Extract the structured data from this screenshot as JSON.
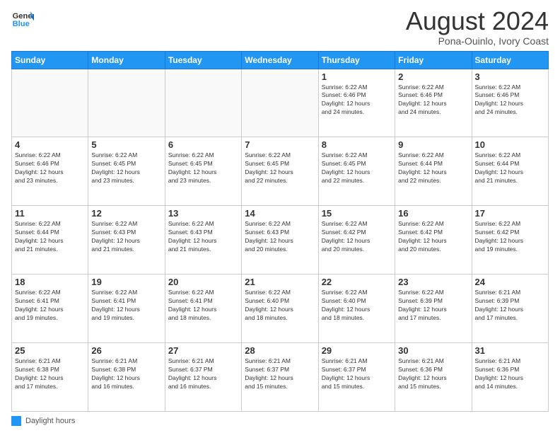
{
  "logo": {
    "line1": "General",
    "line2": "Blue"
  },
  "title": "August 2024",
  "subtitle": "Pona-Ouinlo, Ivory Coast",
  "days_of_week": [
    "Sunday",
    "Monday",
    "Tuesday",
    "Wednesday",
    "Thursday",
    "Friday",
    "Saturday"
  ],
  "legend": "Daylight hours",
  "weeks": [
    [
      {
        "day": "",
        "info": ""
      },
      {
        "day": "",
        "info": ""
      },
      {
        "day": "",
        "info": ""
      },
      {
        "day": "",
        "info": ""
      },
      {
        "day": "1",
        "info": "Sunrise: 6:22 AM\nSunset: 6:46 PM\nDaylight: 12 hours\nand 24 minutes."
      },
      {
        "day": "2",
        "info": "Sunrise: 6:22 AM\nSunset: 6:46 PM\nDaylight: 12 hours\nand 24 minutes."
      },
      {
        "day": "3",
        "info": "Sunrise: 6:22 AM\nSunset: 6:46 PM\nDaylight: 12 hours\nand 24 minutes."
      }
    ],
    [
      {
        "day": "4",
        "info": "Sunrise: 6:22 AM\nSunset: 6:46 PM\nDaylight: 12 hours\nand 23 minutes."
      },
      {
        "day": "5",
        "info": "Sunrise: 6:22 AM\nSunset: 6:45 PM\nDaylight: 12 hours\nand 23 minutes."
      },
      {
        "day": "6",
        "info": "Sunrise: 6:22 AM\nSunset: 6:45 PM\nDaylight: 12 hours\nand 23 minutes."
      },
      {
        "day": "7",
        "info": "Sunrise: 6:22 AM\nSunset: 6:45 PM\nDaylight: 12 hours\nand 22 minutes."
      },
      {
        "day": "8",
        "info": "Sunrise: 6:22 AM\nSunset: 6:45 PM\nDaylight: 12 hours\nand 22 minutes."
      },
      {
        "day": "9",
        "info": "Sunrise: 6:22 AM\nSunset: 6:44 PM\nDaylight: 12 hours\nand 22 minutes."
      },
      {
        "day": "10",
        "info": "Sunrise: 6:22 AM\nSunset: 6:44 PM\nDaylight: 12 hours\nand 21 minutes."
      }
    ],
    [
      {
        "day": "11",
        "info": "Sunrise: 6:22 AM\nSunset: 6:44 PM\nDaylight: 12 hours\nand 21 minutes."
      },
      {
        "day": "12",
        "info": "Sunrise: 6:22 AM\nSunset: 6:43 PM\nDaylight: 12 hours\nand 21 minutes."
      },
      {
        "day": "13",
        "info": "Sunrise: 6:22 AM\nSunset: 6:43 PM\nDaylight: 12 hours\nand 21 minutes."
      },
      {
        "day": "14",
        "info": "Sunrise: 6:22 AM\nSunset: 6:43 PM\nDaylight: 12 hours\nand 20 minutes."
      },
      {
        "day": "15",
        "info": "Sunrise: 6:22 AM\nSunset: 6:42 PM\nDaylight: 12 hours\nand 20 minutes."
      },
      {
        "day": "16",
        "info": "Sunrise: 6:22 AM\nSunset: 6:42 PM\nDaylight: 12 hours\nand 20 minutes."
      },
      {
        "day": "17",
        "info": "Sunrise: 6:22 AM\nSunset: 6:42 PM\nDaylight: 12 hours\nand 19 minutes."
      }
    ],
    [
      {
        "day": "18",
        "info": "Sunrise: 6:22 AM\nSunset: 6:41 PM\nDaylight: 12 hours\nand 19 minutes."
      },
      {
        "day": "19",
        "info": "Sunrise: 6:22 AM\nSunset: 6:41 PM\nDaylight: 12 hours\nand 19 minutes."
      },
      {
        "day": "20",
        "info": "Sunrise: 6:22 AM\nSunset: 6:41 PM\nDaylight: 12 hours\nand 18 minutes."
      },
      {
        "day": "21",
        "info": "Sunrise: 6:22 AM\nSunset: 6:40 PM\nDaylight: 12 hours\nand 18 minutes."
      },
      {
        "day": "22",
        "info": "Sunrise: 6:22 AM\nSunset: 6:40 PM\nDaylight: 12 hours\nand 18 minutes."
      },
      {
        "day": "23",
        "info": "Sunrise: 6:22 AM\nSunset: 6:39 PM\nDaylight: 12 hours\nand 17 minutes."
      },
      {
        "day": "24",
        "info": "Sunrise: 6:21 AM\nSunset: 6:39 PM\nDaylight: 12 hours\nand 17 minutes."
      }
    ],
    [
      {
        "day": "25",
        "info": "Sunrise: 6:21 AM\nSunset: 6:38 PM\nDaylight: 12 hours\nand 17 minutes."
      },
      {
        "day": "26",
        "info": "Sunrise: 6:21 AM\nSunset: 6:38 PM\nDaylight: 12 hours\nand 16 minutes."
      },
      {
        "day": "27",
        "info": "Sunrise: 6:21 AM\nSunset: 6:37 PM\nDaylight: 12 hours\nand 16 minutes."
      },
      {
        "day": "28",
        "info": "Sunrise: 6:21 AM\nSunset: 6:37 PM\nDaylight: 12 hours\nand 15 minutes."
      },
      {
        "day": "29",
        "info": "Sunrise: 6:21 AM\nSunset: 6:37 PM\nDaylight: 12 hours\nand 15 minutes."
      },
      {
        "day": "30",
        "info": "Sunrise: 6:21 AM\nSunset: 6:36 PM\nDaylight: 12 hours\nand 15 minutes."
      },
      {
        "day": "31",
        "info": "Sunrise: 6:21 AM\nSunset: 6:36 PM\nDaylight: 12 hours\nand 14 minutes."
      }
    ]
  ]
}
